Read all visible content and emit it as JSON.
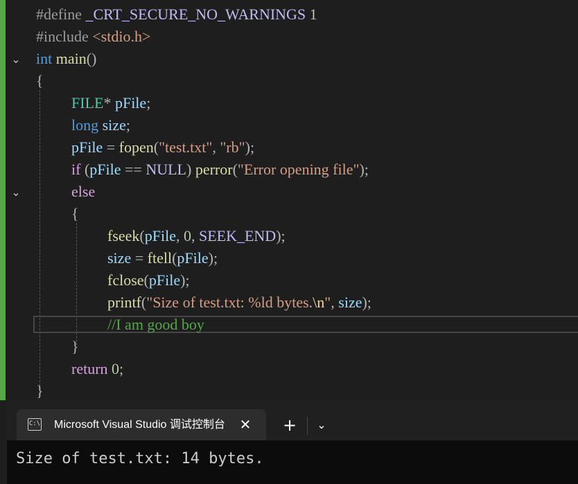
{
  "editor": {
    "lines": {
      "l1": {
        "a": "#define ",
        "b": "_CRT_SECURE_NO_WARNINGS",
        "c": " ",
        "d": "1"
      },
      "l2": {
        "a": "#include ",
        "b": "<stdio.h>"
      },
      "l3": {
        "a": "int",
        "b": " ",
        "c": "main",
        "d": "()"
      },
      "l4": {
        "a": "{"
      },
      "l5": {
        "a": "FILE",
        "b": "* ",
        "c": "pFile",
        "d": ";"
      },
      "l6": {
        "a": "long",
        "b": " ",
        "c": "size",
        "d": ";"
      },
      "l7": {
        "a": "pFile",
        "b": " = ",
        "c": "fopen",
        "d": "(",
        "e": "\"test.txt\"",
        "f": ", ",
        "g": "\"rb\"",
        "h": ");"
      },
      "l8": {
        "a": "if",
        "b": " (",
        "c": "pFile",
        "d": " == ",
        "e": "NULL",
        "f": ") ",
        "g": "perror",
        "h": "(",
        "i": "\"Error opening file\"",
        "j": ");"
      },
      "l9": {
        "a": "else"
      },
      "l10": {
        "a": "{"
      },
      "l11": {
        "a": "fseek",
        "b": "(",
        "c": "pFile",
        "d": ", ",
        "e": "0",
        "f": ", ",
        "g": "SEEK_END",
        "h": ");"
      },
      "l12": {
        "a": "size",
        "b": " = ",
        "c": "ftell",
        "d": "(",
        "e": "pFile",
        "f": ");"
      },
      "l13": {
        "a": "fclose",
        "b": "(",
        "c": "pFile",
        "d": ");"
      },
      "l14": {
        "a": "printf",
        "b": "(",
        "c": "\"Size of test.txt: %ld bytes.",
        "d": "\\n",
        "e": "\"",
        "f": ", ",
        "g": "size",
        "h": ");"
      },
      "l15": {
        "a": "//I am good boy"
      },
      "l16": {
        "a": "}"
      },
      "l17": {
        "a": "return",
        "b": " ",
        "c": "0",
        "d": ";"
      },
      "l18": {
        "a": "}"
      }
    },
    "fold_icon": "chevron-down-icon"
  },
  "terminal": {
    "tab_icon_text": "C:\\",
    "tab_title": "Microsoft Visual Studio 调试控制台",
    "close_glyph": "✕",
    "new_tab_glyph": "+",
    "dropdown_glyph": "⌄",
    "output": "Size of test.txt: 14 bytes."
  },
  "colors": {
    "editor_bg": "#1e1e1e",
    "keyword": "#569cd6",
    "control_keyword": "#d8a0df",
    "function": "#dcdcaa",
    "variable": "#9cdcfe",
    "string": "#d69d85",
    "number": "#b5cea8",
    "comment": "#57a64a",
    "macro": "#bebbf5",
    "type": "#4ec9b0",
    "terminal_bg": "#0c0c0c"
  }
}
